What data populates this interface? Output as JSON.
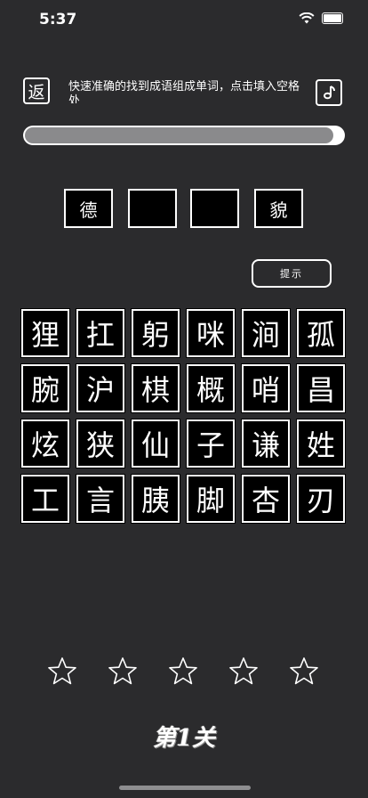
{
  "status_bar": {
    "time": "5:37"
  },
  "header": {
    "back_label": "返",
    "instructions": "快速准确的找到成语组成单词，点击填入空格处",
    "music_icon": "music-note-icon"
  },
  "progress": {
    "fraction": 0.97
  },
  "answer_slots": [
    "德",
    "",
    "",
    "貌"
  ],
  "hint_label": "提示",
  "tiles": [
    [
      "狸",
      "扛",
      "躬",
      "咪",
      "涧",
      "孤"
    ],
    [
      "腕",
      "沪",
      "棋",
      "概",
      "哨",
      "昌"
    ],
    [
      "炫",
      "狭",
      "仙",
      "子",
      "谦",
      "姓"
    ],
    [
      "工",
      "言",
      "胰",
      "脚",
      "杏",
      "刃"
    ]
  ],
  "stars": {
    "total": 5,
    "filled": 0
  },
  "level_label": "第1关"
}
